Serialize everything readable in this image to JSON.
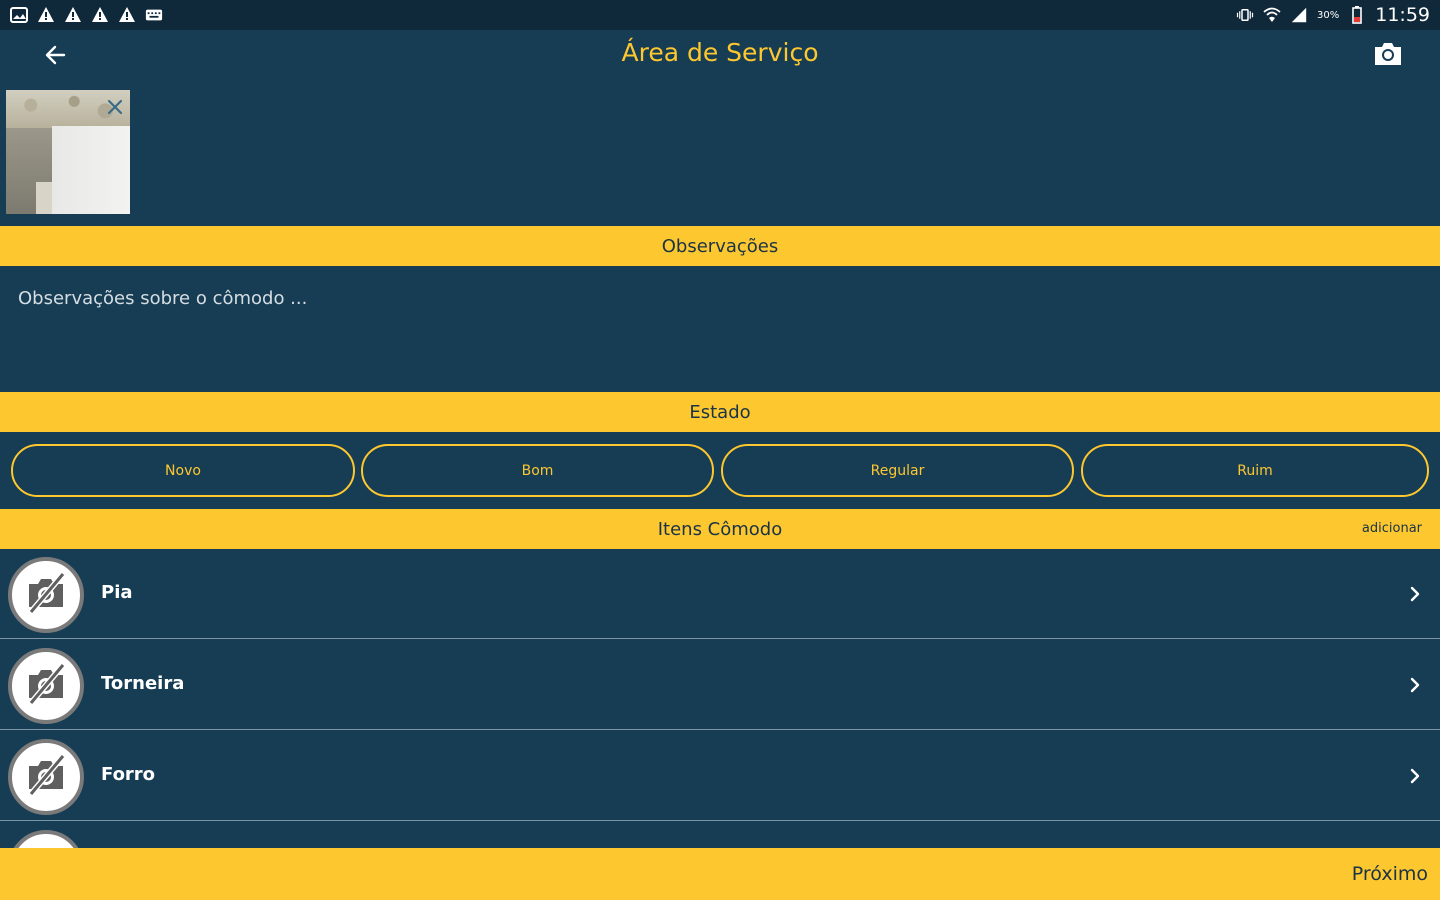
{
  "status_bar": {
    "time": "11:59",
    "battery": "30%",
    "left_icons": [
      "gallery-icon",
      "warning-icon",
      "warning-icon",
      "warning-icon",
      "warning-icon",
      "keyboard-icon"
    ],
    "right_icons": [
      "vibrate-icon",
      "wifi-icon",
      "signal-icon",
      "battery-icon"
    ]
  },
  "app_bar": {
    "title": "Área de Serviço"
  },
  "sections": {
    "observacoes": "Observações",
    "estado": "Estado",
    "itens": "Itens Cômodo",
    "itens_add": "adicionar"
  },
  "observacoes": {
    "placeholder": "Observações sobre o cômodo ...",
    "value": ""
  },
  "estado_options": [
    "Novo",
    "Bom",
    "Regular",
    "Ruim"
  ],
  "items": [
    {
      "label": "Pia"
    },
    {
      "label": "Torneira"
    },
    {
      "label": "Forro"
    }
  ],
  "bottom": {
    "next_label": "Próximo"
  },
  "colors": {
    "background": "#173d55",
    "accent": "#fdc72f",
    "header_text": "#1a3346",
    "divider": "#7d95a4"
  }
}
